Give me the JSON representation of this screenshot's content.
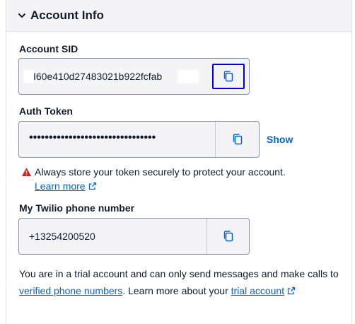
{
  "header": {
    "title": "Account Info",
    "expand_icon": "chevron-down-icon"
  },
  "account_sid": {
    "label": "Account SID",
    "value": "I60e410d27483021b922fcfab",
    "copy_icon": "copy-icon"
  },
  "auth_token": {
    "label": "Auth Token",
    "value": "••••••••••••••••••••••••••••••••",
    "copy_icon": "copy-icon",
    "show_label": "Show"
  },
  "warning": {
    "icon": "warning-icon",
    "text": "Always store your token securely to protect your account.",
    "learn_more": "Learn more",
    "learn_more_icon": "external-link-icon"
  },
  "phone": {
    "label": "My Twilio phone number",
    "value": "+13254200520",
    "copy_icon": "copy-icon"
  },
  "trial": {
    "text_before": "You are in a trial account and can only send messages and make calls to ",
    "link1": "verified phone numbers",
    "text_middle": ". Learn more about your ",
    "link2": "trial account",
    "link2_icon": "external-link-icon"
  },
  "colors": {
    "link": "#0263e0",
    "focus": "#0000dd",
    "warning": "#d61f1f",
    "field_bg": "#f4f4f6"
  }
}
